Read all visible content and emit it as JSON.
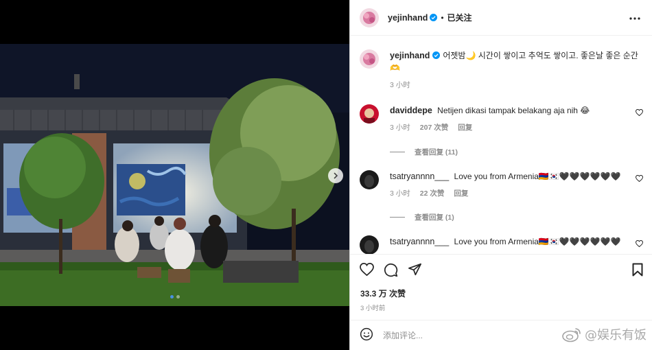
{
  "post": {
    "author": "yejinhand",
    "follow_status": "已关注",
    "separator": "•",
    "caption": "어젯밤🌙 시간이 쌓이고 추억도 쌓이고. 좋은날 좋은 순간🫶",
    "caption_time": "3 小时",
    "likes": "33.3 万 次赞",
    "posted_time": "3 小时前",
    "colors": {
      "verified": "#0095f6",
      "active_dot": "#4a90e2"
    },
    "carousel": {
      "dots": 2,
      "active_index": 0
    }
  },
  "comments": [
    {
      "user": "daviddepe",
      "text": "Netijen dikasi tampak belakang aja nih 😂",
      "time": "3 小时",
      "likes": "207 次赞",
      "reply_label": "回复",
      "view_replies": "查看回复 (11)"
    },
    {
      "user": "tsatryannnn___",
      "text": "Love you from Armenia🇦🇲🇰🇷🖤🖤🖤🖤🖤🖤",
      "time": "3 小时",
      "likes": "22 次赞",
      "reply_label": "回复",
      "view_replies": "查看回复 (1)"
    },
    {
      "user": "tsatryannnn___",
      "text": "Love you from Armenia🇦🇲🇰🇷🖤🖤🖤🖤🖤🖤"
    }
  ],
  "composer": {
    "placeholder": "添加评论..."
  },
  "watermark": {
    "text": "@娱乐有饭"
  },
  "icons": {
    "next": "chevron-right-icon",
    "more": "more-horizontal-icon",
    "like": "heart-icon",
    "comment": "comment-icon",
    "share": "share-icon",
    "save": "bookmark-icon",
    "emoji": "emoji-icon"
  }
}
